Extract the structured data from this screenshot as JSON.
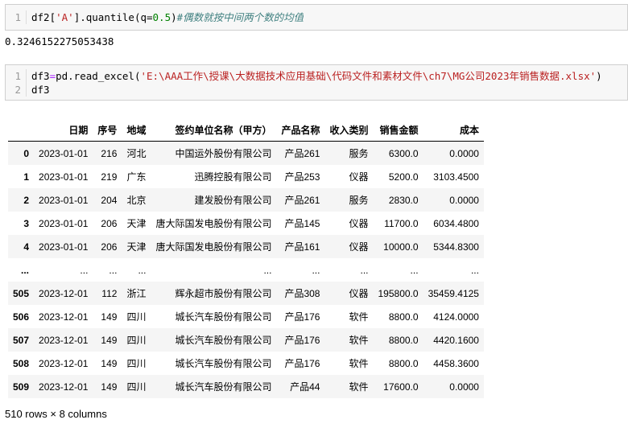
{
  "cell1": {
    "line_number": "1",
    "code_prefix": "df2[",
    "code_str": "'A'",
    "code_mid": "].quantile(q=",
    "code_num": "0.5",
    "code_close": ")",
    "code_comment": "#偶数就按中间两个数的均值"
  },
  "output1": "0.3246152275053438",
  "cell2": {
    "line1_number": "1",
    "line1_prefix": "df3",
    "line1_op": "=",
    "line1_call": "pd.read_excel(",
    "line1_str": "'E:\\AAA工作\\授课\\大数据技术应用基础\\代码文件和素材文件\\ch7\\MG公司2023年销售数据.xlsx'",
    "line1_close": ")",
    "line2_number": "2",
    "line2_code": "df3"
  },
  "table": {
    "columns": [
      "",
      "日期",
      "序号",
      "地域",
      "签约单位名称（甲方）",
      "产品名称",
      "收入类别",
      "销售金额",
      "成本"
    ],
    "rows": [
      [
        "0",
        "2023-01-01",
        "216",
        "河北",
        "中国运外股份有限公司",
        "产品261",
        "服务",
        "6300.0",
        "0.0000"
      ],
      [
        "1",
        "2023-01-01",
        "219",
        "广东",
        "迅腾控股有限公司",
        "产品253",
        "仪器",
        "5200.0",
        "3103.4500"
      ],
      [
        "2",
        "2023-01-01",
        "204",
        "北京",
        "建发股份有限公司",
        "产品261",
        "服务",
        "2830.0",
        "0.0000"
      ],
      [
        "3",
        "2023-01-01",
        "206",
        "天津",
        "唐大际国发电股份有限公司",
        "产品145",
        "仪器",
        "11700.0",
        "6034.4800"
      ],
      [
        "4",
        "2023-01-01",
        "206",
        "天津",
        "唐大际国发电股份有限公司",
        "产品161",
        "仪器",
        "10000.0",
        "5344.8300"
      ],
      [
        "...",
        "...",
        "...",
        "...",
        "...",
        "...",
        "...",
        "...",
        "..."
      ],
      [
        "505",
        "2023-12-01",
        "112",
        "浙江",
        "辉永超市股份有限公司",
        "产品308",
        "仪器",
        "195800.0",
        "35459.4125"
      ],
      [
        "506",
        "2023-12-01",
        "149",
        "四川",
        "城长汽车股份有限公司",
        "产品176",
        "软件",
        "8800.0",
        "4124.0000"
      ],
      [
        "507",
        "2023-12-01",
        "149",
        "四川",
        "城长汽车股份有限公司",
        "产品176",
        "软件",
        "8800.0",
        "4420.1600"
      ],
      [
        "508",
        "2023-12-01",
        "149",
        "四川",
        "城长汽车股份有限公司",
        "产品176",
        "软件",
        "8800.0",
        "4458.3600"
      ],
      [
        "509",
        "2023-12-01",
        "149",
        "四川",
        "城长汽车股份有限公司",
        "产品44",
        "软件",
        "17600.0",
        "0.0000"
      ]
    ]
  },
  "footer": "510 rows × 8 columns"
}
